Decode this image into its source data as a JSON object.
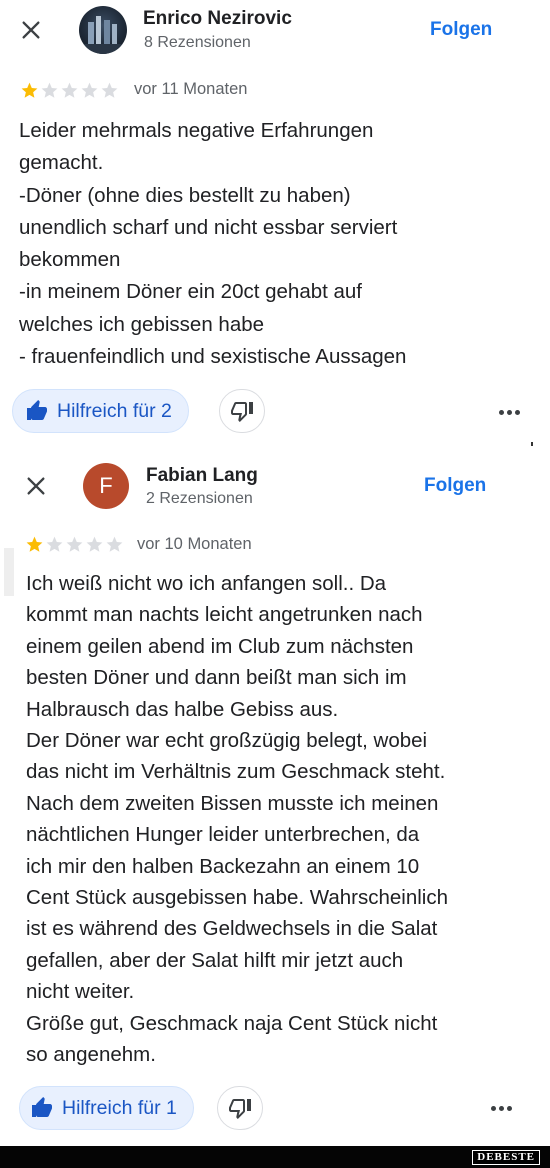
{
  "reviews": [
    {
      "reviewer_name": "Enrico Nezirovic",
      "review_count": "8 Rezensionen",
      "follow_label": "Folgen",
      "rating": 1,
      "max_rating": 5,
      "time": "vor 11 Monaten",
      "lines": [
        "Leider mehrmals negative Erfahrungen",
        "gemacht.",
        "-Döner (ohne dies bestellt zu haben)",
        "unendlich scharf und nicht essbar serviert",
        "bekommen",
        "-in meinem Döner ein 20ct gehabt auf",
        "welches ich gebissen habe",
        "- frauenfeindlich und sexistische Aussagen"
      ],
      "helpful_label": "Hilfreich für 2"
    },
    {
      "reviewer_name": "Fabian Lang",
      "avatar_letter": "F",
      "avatar_color": "#b84a2c",
      "review_count": "2 Rezensionen",
      "follow_label": "Folgen",
      "rating": 1,
      "max_rating": 5,
      "time": "vor 10 Monaten",
      "lines": [
        "Ich weiß nicht wo ich anfangen soll.. Da",
        "kommt man nachts leicht angetrunken nach",
        "einem geilen abend im Club zum nächsten",
        "besten Döner und dann beißt man sich im",
        "Halbrausch das halbe Gebiss aus.",
        "Der Döner war echt großzügig belegt, wobei",
        "das nicht im Verhältnis zum Geschmack steht.",
        "Nach dem zweiten Bissen musste ich meinen",
        "nächtlichen Hunger leider unterbrechen, da",
        "ich mir den halben Backezahn an einem 10",
        "Cent Stück ausgebissen habe. Wahrscheinlich",
        "ist es während des Geldwechsels in die Salat",
        "gefallen, aber der Salat hilft mir jetzt auch",
        "nicht weiter.",
        "Größe gut, Geschmack naja Cent Stück nicht",
        "so angenehm."
      ],
      "helpful_label": "Hilfreich für 1"
    }
  ],
  "colors": {
    "accent": "#1a73e8",
    "star_filled": "#fbbc04",
    "star_empty": "#dadce0",
    "helpful_bg": "#e8f0fe"
  },
  "icons": {
    "close": "close-icon",
    "thumb_up": "thumb-up-icon",
    "thumb_down": "thumb-down-icon",
    "more": "more-horizontal-icon",
    "star": "star-icon"
  },
  "watermark": "DEBESTE"
}
